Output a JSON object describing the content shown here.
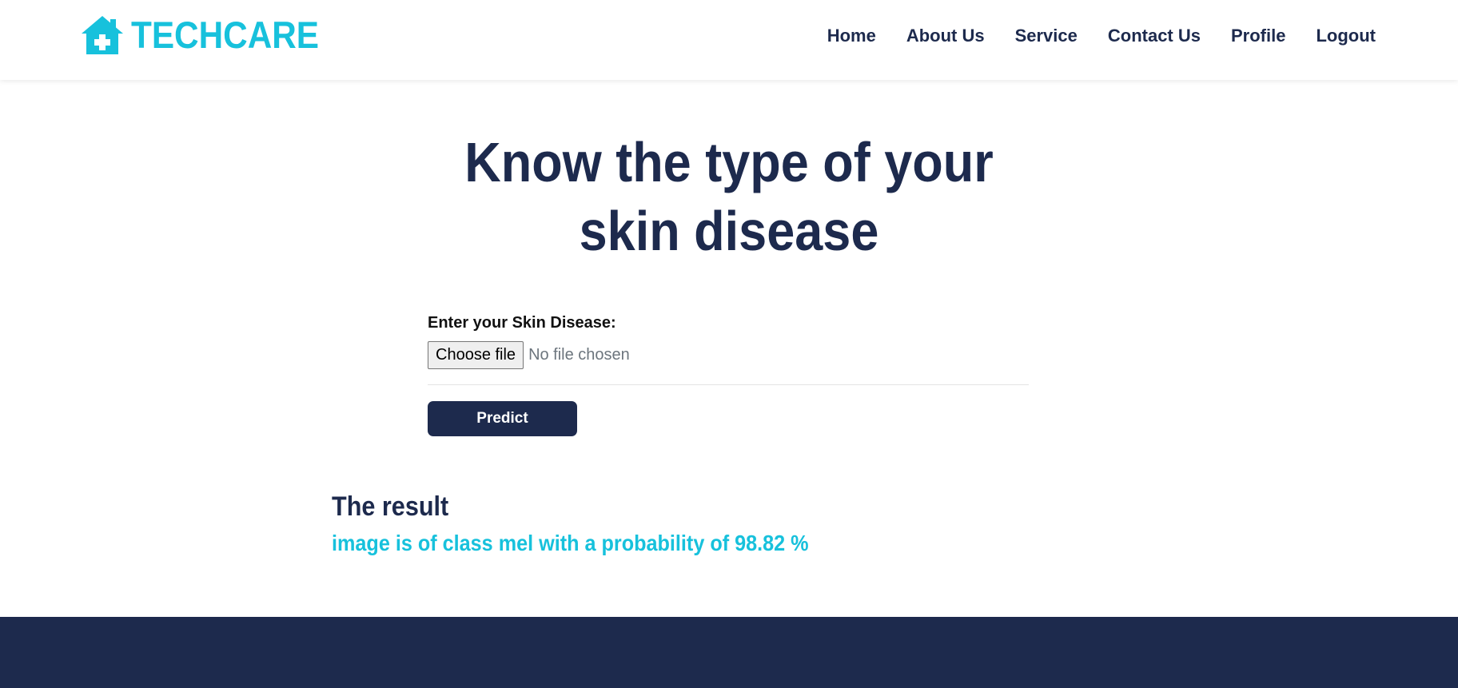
{
  "brand": {
    "name": "TECHCARE",
    "icon": "house-medical-icon",
    "color": "#17c1dc"
  },
  "nav": {
    "items": [
      {
        "label": "Home"
      },
      {
        "label": "About Us"
      },
      {
        "label": "Service"
      },
      {
        "label": "Contact Us"
      },
      {
        "label": "Profile"
      },
      {
        "label": "Logout"
      }
    ]
  },
  "hero": {
    "title_line1": "Know the type of your",
    "title_line2": "skin disease"
  },
  "form": {
    "label": "Enter your Skin Disease:",
    "file_button": "Choose file",
    "file_status": "No file chosen",
    "submit_label": "Predict"
  },
  "result": {
    "heading": "The result",
    "text": "image is of class mel with a probability of 98.82 %"
  },
  "colors": {
    "primary": "#1d2a4d",
    "accent": "#17c1dc"
  }
}
